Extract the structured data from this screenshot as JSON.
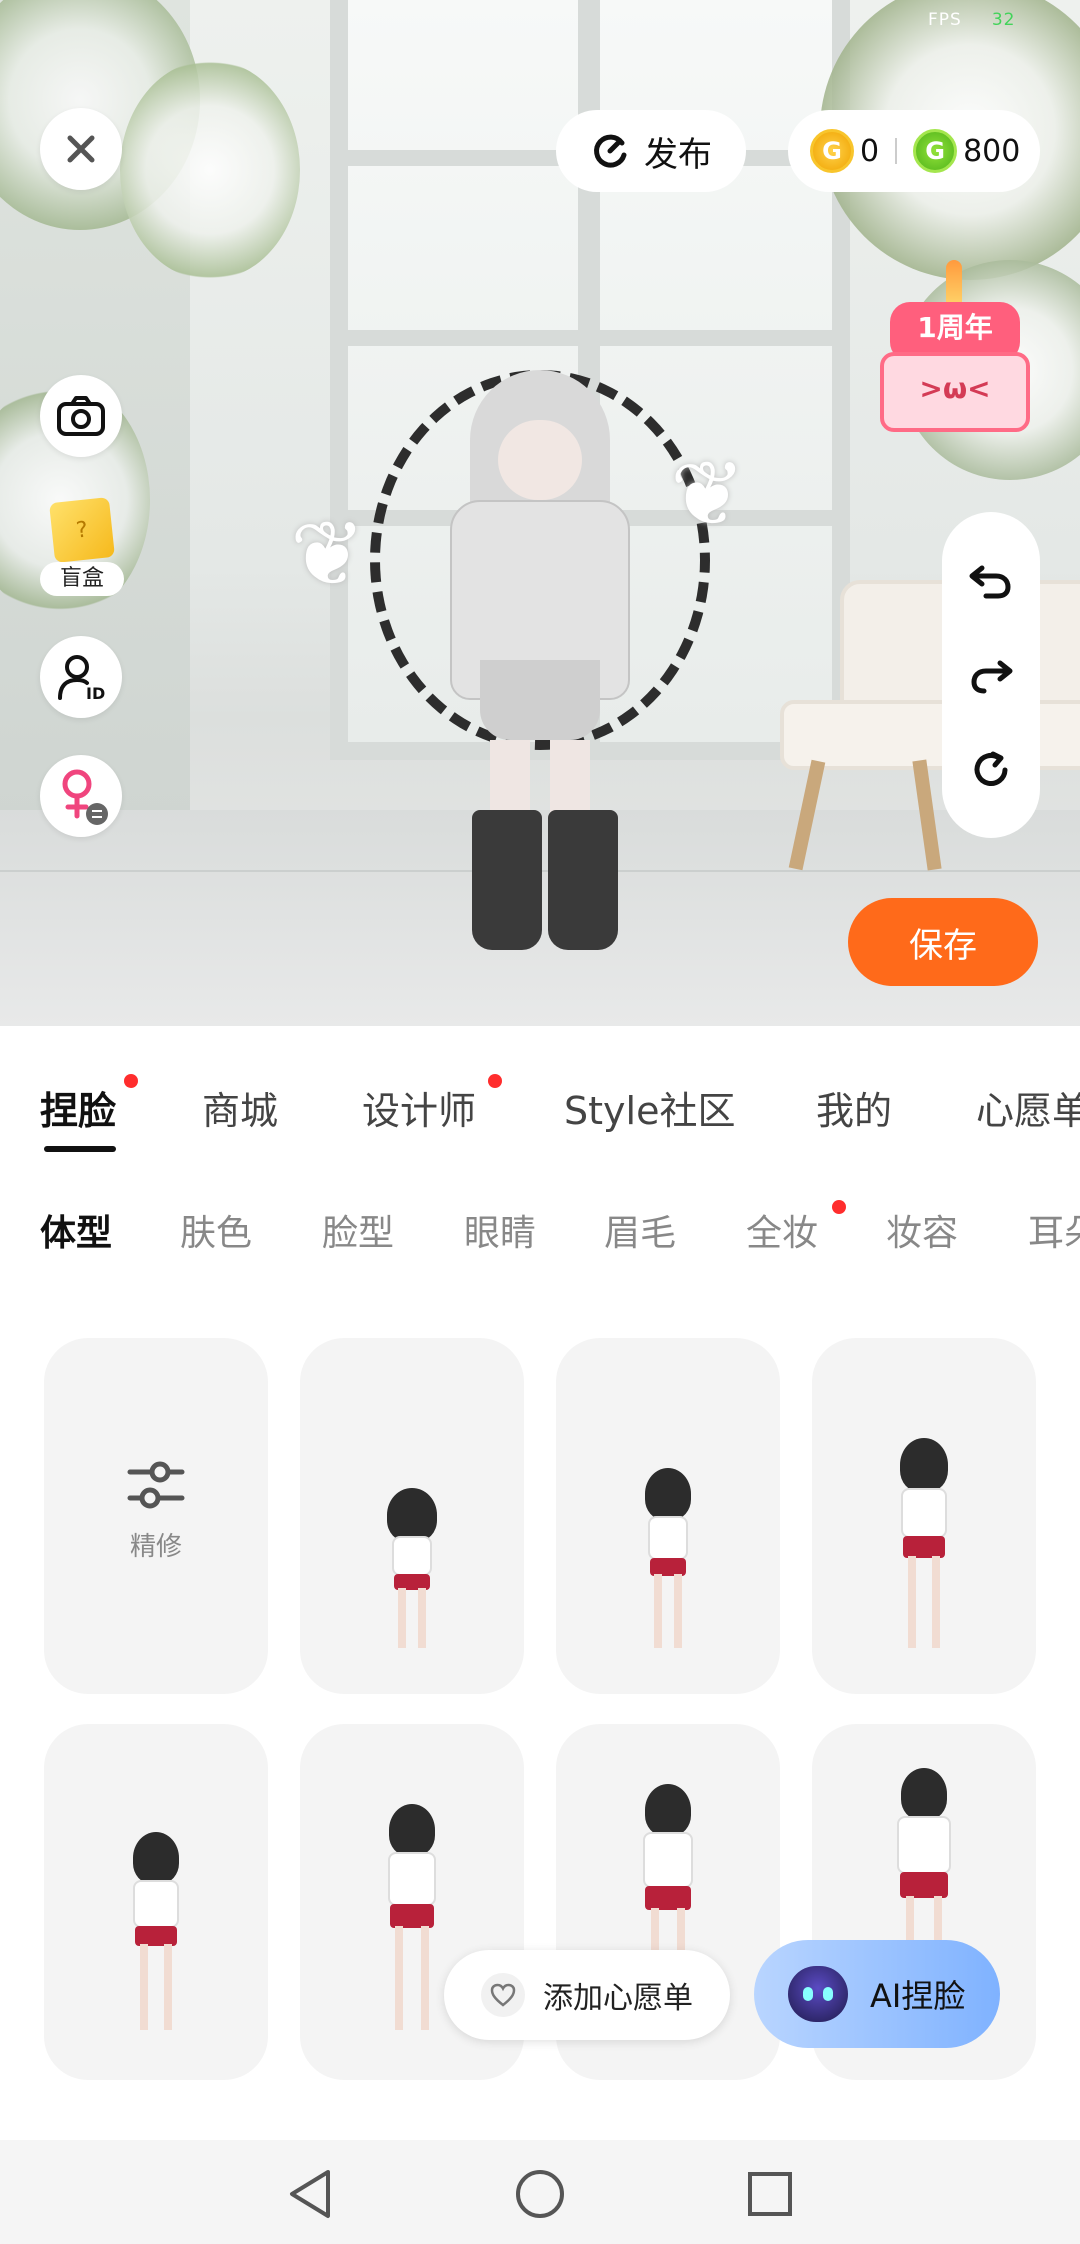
{
  "status": {
    "fps_label": "FPS",
    "fps_value": "32"
  },
  "top_bar": {
    "publish_label": "发布",
    "gold_coin_icon": "coin-gold-icon",
    "gold_value": "0",
    "green_coin_icon": "coin-green-icon",
    "green_value": "800"
  },
  "left_rail": {
    "close_icon": "close-icon",
    "camera_icon": "camera-icon",
    "blindbox_label": "盲盒",
    "id_icon": "user-id-icon",
    "gender_icon": "female-switch-icon"
  },
  "anniversary": {
    "label": "1周年",
    "face": ">ω<"
  },
  "right_rail": {
    "items": [
      "undo-icon",
      "redo-icon",
      "reset-icon"
    ]
  },
  "save_label": "保存",
  "main_tabs": [
    {
      "label": "捏脸",
      "active": true,
      "dot": true
    },
    {
      "label": "商城",
      "active": false,
      "dot": false
    },
    {
      "label": "设计师",
      "active": false,
      "dot": true
    },
    {
      "label": "Style社区",
      "active": false,
      "dot": false
    },
    {
      "label": "我的",
      "active": false,
      "dot": false
    },
    {
      "label": "心愿单",
      "active": false,
      "dot": false
    }
  ],
  "sub_tabs": [
    {
      "label": "体型",
      "active": true
    },
    {
      "label": "肤色"
    },
    {
      "label": "脸型"
    },
    {
      "label": "眼睛"
    },
    {
      "label": "眉毛"
    },
    {
      "label": "全妆",
      "dot": true
    },
    {
      "label": "妆容"
    },
    {
      "label": "耳朵"
    }
  ],
  "grid": {
    "fine_tune_label": "精修",
    "fine_tune_icon": "sliders-icon"
  },
  "wishlist_label": "添加心愿单",
  "ai_label": "AI捏脸",
  "nav": {
    "back": "back-icon",
    "home": "home-icon",
    "recents": "recents-icon"
  }
}
